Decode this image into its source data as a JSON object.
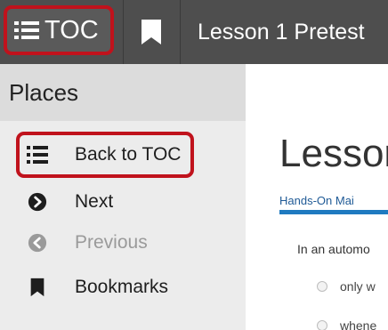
{
  "header": {
    "toc_label": "TOC",
    "lesson_title": "Lesson 1 Pretest"
  },
  "sidebar": {
    "title": "Places",
    "items": [
      {
        "label": "Back to TOC",
        "icon": "list-icon",
        "state": "highlighted"
      },
      {
        "label": "Next",
        "icon": "circle-chevron-right-icon",
        "state": "enabled"
      },
      {
        "label": "Previous",
        "icon": "circle-chevron-left-icon",
        "state": "disabled"
      },
      {
        "label": "Bookmarks",
        "icon": "bookmark-icon",
        "state": "enabled"
      }
    ]
  },
  "content": {
    "title": "Lessor",
    "subtitle": "Hands-On Mai",
    "question": "In an automo",
    "options": [
      "only w",
      "whene"
    ]
  },
  "colors": {
    "topbar": "#4e4e4e",
    "highlight_border": "#c0121c",
    "sidebar_bg": "#ececec",
    "sidebar_header_bg": "#dcdcdc",
    "accent_blue": "#1f7ac0"
  }
}
